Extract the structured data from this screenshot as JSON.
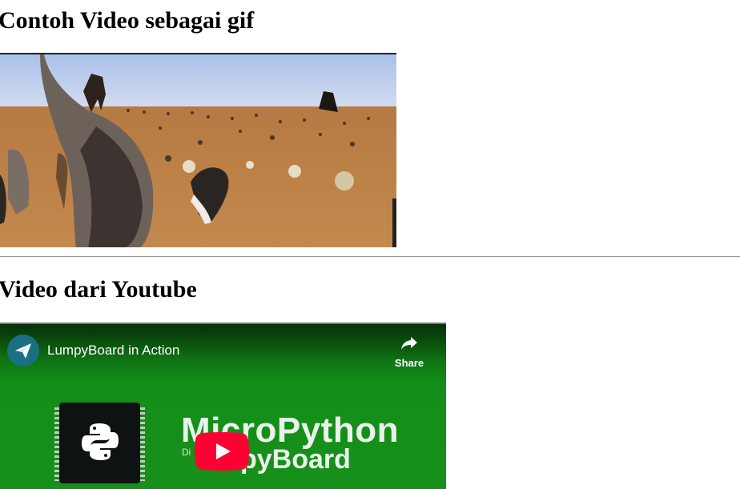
{
  "section_gif": {
    "heading": "Contoh Video sebagai gif"
  },
  "section_youtube": {
    "heading": "Video dari Youtube",
    "player": {
      "video_title": "LumpyBoard in Action",
      "share_label": "Share",
      "thumbnail_line1": "MicroPython",
      "thumbnail_line2": "pyBoard",
      "thumbnail_small": "Di",
      "colors": {
        "background": "#168f1a",
        "play_button": "#ff0033"
      }
    }
  }
}
